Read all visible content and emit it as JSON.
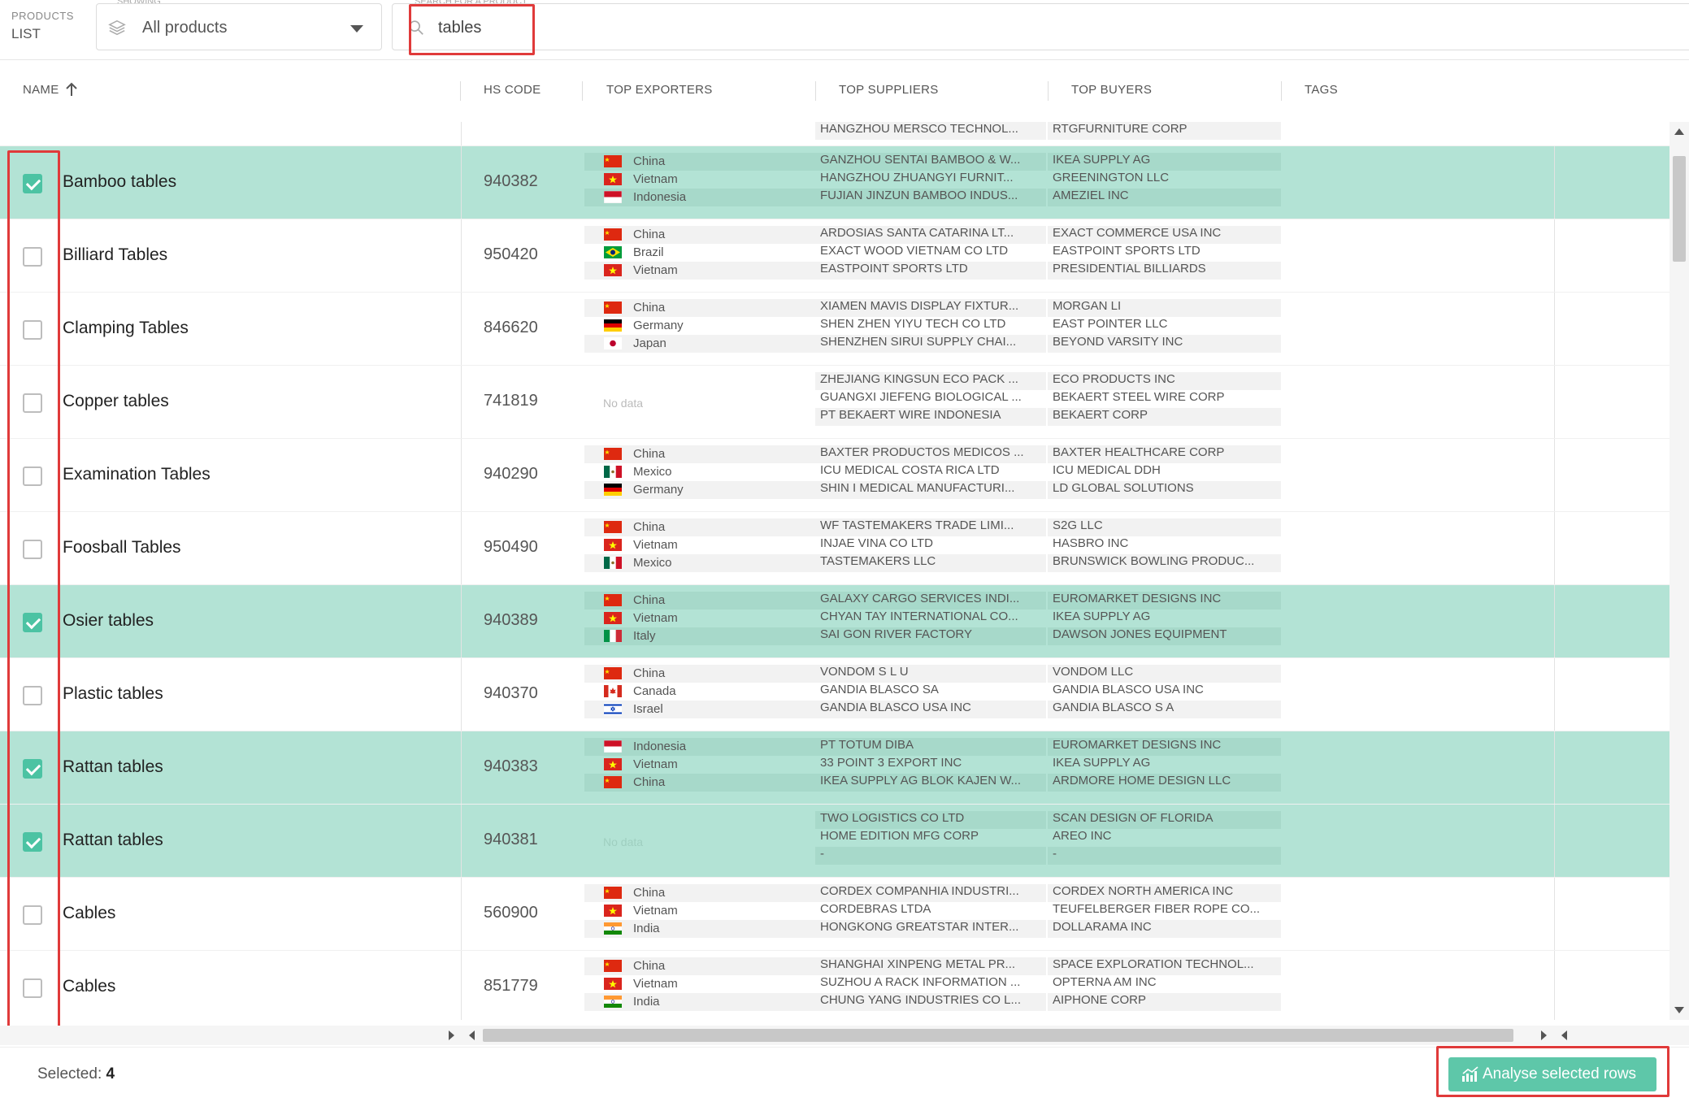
{
  "topbar": {
    "products_label": "PRODUCTS",
    "products_sub": "LIST",
    "showing_caption": "SHOWING",
    "showing_value": "All products",
    "search_caption": "SEARCH FOR A PRODUCT",
    "search_value": "tables"
  },
  "columns": {
    "name": "NAME",
    "hs_code": "HS CODE",
    "top_exporters": "TOP EXPORTERS",
    "top_suppliers": "TOP SUPPLIERS",
    "top_buyers": "TOP BUYERS",
    "tags": "TAGS"
  },
  "partial_row": {
    "supplier": "HANGZHOU MERSCO TECHNOL...",
    "buyer": "RTGFURNITURE CORP"
  },
  "rows": [
    {
      "name": "Bamboo tables",
      "hs": "940382",
      "selected": true,
      "exporters": [
        "China",
        "Vietnam",
        "Indonesia"
      ],
      "suppliers": [
        "GANZHOU SENTAI BAMBOO & W...",
        "HANGZHOU ZHUANGYI FURNIT...",
        "FUJIAN JINZUN BAMBOO INDUS..."
      ],
      "buyers": [
        "IKEA SUPPLY AG",
        "GREENINGTON LLC",
        "AMEZIEL INC"
      ]
    },
    {
      "name": "Billiard Tables",
      "hs": "950420",
      "selected": false,
      "exporters": [
        "China",
        "Brazil",
        "Vietnam"
      ],
      "suppliers": [
        "ARDOSIAS SANTA CATARINA LT...",
        "EXACT WOOD VIETNAM CO LTD",
        "EASTPOINT SPORTS LTD"
      ],
      "buyers": [
        "EXACT COMMERCE USA INC",
        "EASTPOINT SPORTS LTD",
        "PRESIDENTIAL BILLIARDS"
      ]
    },
    {
      "name": "Clamping Tables",
      "hs": "846620",
      "selected": false,
      "exporters": [
        "China",
        "Germany",
        "Japan"
      ],
      "suppliers": [
        "XIAMEN MAVIS DISPLAY FIXTUR...",
        "SHEN ZHEN YIYU TECH CO LTD",
        "SHENZHEN SIRUI SUPPLY CHAI..."
      ],
      "buyers": [
        "MORGAN LI",
        "EAST POINTER LLC",
        "BEYOND VARSITY INC"
      ]
    },
    {
      "name": "Copper tables",
      "hs": "741819",
      "selected": false,
      "exporters": [],
      "nodata": "No data",
      "suppliers": [
        "ZHEJIANG KINGSUN ECO PACK ...",
        "GUANGXI JIEFENG BIOLOGICAL ...",
        "PT BEKAERT WIRE INDONESIA"
      ],
      "buyers": [
        "ECO PRODUCTS INC",
        "BEKAERT STEEL WIRE CORP",
        "BEKAERT CORP"
      ]
    },
    {
      "name": "Examination Tables",
      "hs": "940290",
      "selected": false,
      "exporters": [
        "China",
        "Mexico",
        "Germany"
      ],
      "suppliers": [
        "BAXTER PRODUCTOS MEDICOS ...",
        "ICU MEDICAL COSTA RICA LTD",
        "SHIN I MEDICAL MANUFACTURI..."
      ],
      "buyers": [
        "BAXTER HEALTHCARE CORP",
        "ICU MEDICAL DDH",
        "LD GLOBAL SOLUTIONS"
      ]
    },
    {
      "name": "Foosball Tables",
      "hs": "950490",
      "selected": false,
      "exporters": [
        "China",
        "Vietnam",
        "Mexico"
      ],
      "suppliers": [
        "WF TASTEMAKERS TRADE LIMI...",
        "INJAE VINA CO LTD",
        "TASTEMAKERS LLC"
      ],
      "buyers": [
        "S2G LLC",
        "HASBRO INC",
        "BRUNSWICK BOWLING PRODUC..."
      ]
    },
    {
      "name": "Osier tables",
      "hs": "940389",
      "selected": true,
      "exporters": [
        "China",
        "Vietnam",
        "Italy"
      ],
      "suppliers": [
        "GALAXY CARGO SERVICES INDI...",
        "CHYAN TAY INTERNATIONAL CO...",
        "SAI GON RIVER FACTORY"
      ],
      "buyers": [
        "EUROMARKET DESIGNS INC",
        "IKEA SUPPLY AG",
        "DAWSON JONES EQUIPMENT"
      ]
    },
    {
      "name": "Plastic tables",
      "hs": "940370",
      "selected": false,
      "exporters": [
        "China",
        "Canada",
        "Israel"
      ],
      "suppliers": [
        "VONDOM S L U",
        "GANDIA BLASCO SA",
        "GANDIA BLASCO USA INC"
      ],
      "buyers": [
        "VONDOM LLC",
        "GANDIA BLASCO USA INC",
        "GANDIA BLASCO S A"
      ]
    },
    {
      "name": "Rattan tables",
      "hs": "940383",
      "selected": true,
      "exporters": [
        "Indonesia",
        "Vietnam",
        "China"
      ],
      "suppliers": [
        "PT TOTUM DIBA",
        "33 POINT 3 EXPORT INC",
        "IKEA SUPPLY AG BLOK KAJEN W..."
      ],
      "buyers": [
        "EUROMARKET DESIGNS INC",
        "IKEA SUPPLY AG",
        "ARDMORE HOME DESIGN LLC"
      ]
    },
    {
      "name": "Rattan tables",
      "hs": "940381",
      "selected": true,
      "exporters": [],
      "nodata": "No data",
      "suppliers": [
        "TWO LOGISTICS CO LTD",
        "HOME EDITION MFG CORP",
        "-"
      ],
      "buyers": [
        "SCAN DESIGN OF FLORIDA",
        "AREO INC",
        "-"
      ]
    },
    {
      "name": "Cables",
      "hs": "560900",
      "selected": false,
      "exporters": [
        "China",
        "Vietnam",
        "India"
      ],
      "suppliers": [
        "CORDEX COMPANHIA INDUSTRI...",
        "CORDEBRAS LTDA",
        "HONGKONG GREATSTAR INTER..."
      ],
      "buyers": [
        "CORDEX NORTH AMERICA INC",
        "TEUFELBERGER FIBER ROPE CO...",
        "DOLLARAMA INC"
      ]
    },
    {
      "name": "Cables",
      "hs": "851779",
      "selected": false,
      "exporters": [
        "China",
        "Vietnam",
        "India"
      ],
      "suppliers": [
        "SHANGHAI XINPENG METAL PR...",
        "SUZHOU A RACK INFORMATION ...",
        "CHUNG YANG INDUSTRIES CO L..."
      ],
      "buyers": [
        "SPACE EXPLORATION TECHNOL...",
        "OPTERNA AM INC",
        "AIPHONE CORP"
      ]
    }
  ],
  "footer": {
    "selected_label": "Selected:",
    "selected_count": "4",
    "analyse_button": "Analyse selected rows"
  },
  "colors": {
    "accent": "#5ec7a9",
    "selected_row": "#b3e3d5",
    "highlight_box": "#e03a3a"
  }
}
